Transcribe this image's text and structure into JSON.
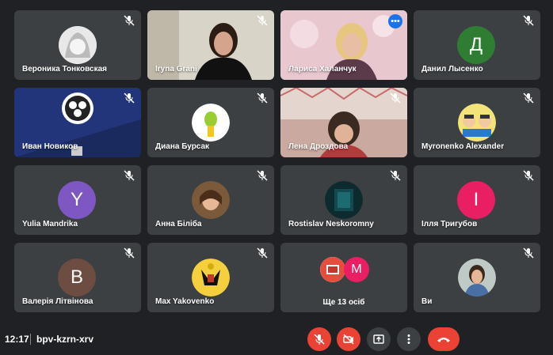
{
  "participants": [
    {
      "name": "Вероника Тонковская"
    },
    {
      "name": "Iryna Grani"
    },
    {
      "name": "Лариса Халанчук"
    },
    {
      "name": "Данил Лысенко",
      "initial": "Д",
      "color": "#2e7d32"
    },
    {
      "name": "Иван Новиков"
    },
    {
      "name": "Диана Бурсак"
    },
    {
      "name": "Лена Дроздова"
    },
    {
      "name": "Myronenko Alexander"
    },
    {
      "name": "Yulia Mandrika",
      "initial": "Y",
      "color": "#7e57c2"
    },
    {
      "name": "Анна Біліба"
    },
    {
      "name": "Rostislav Neskoromny"
    },
    {
      "name": "Ілля Тригубов",
      "initial": "І",
      "color": "#e91e63"
    },
    {
      "name": "Валерія Літвінова",
      "initial": "B",
      "color": "#6d4c41"
    },
    {
      "name": "Max Yakovenko"
    },
    {
      "name": "Ще 13 осіб",
      "initial": "M",
      "color": "#e91e63"
    },
    {
      "name": "Ви"
    }
  ],
  "meeting": {
    "time": "12:17",
    "code": "bpv-kzrn-xrv"
  },
  "colors": {
    "background": "#202124",
    "tile": "#3c4043",
    "danger": "#ea4335",
    "accent": "#8ab4f8"
  },
  "icons": [
    "mic-off-icon",
    "camera-off-icon",
    "present-icon",
    "more-vert-icon",
    "hang-up-icon"
  ]
}
